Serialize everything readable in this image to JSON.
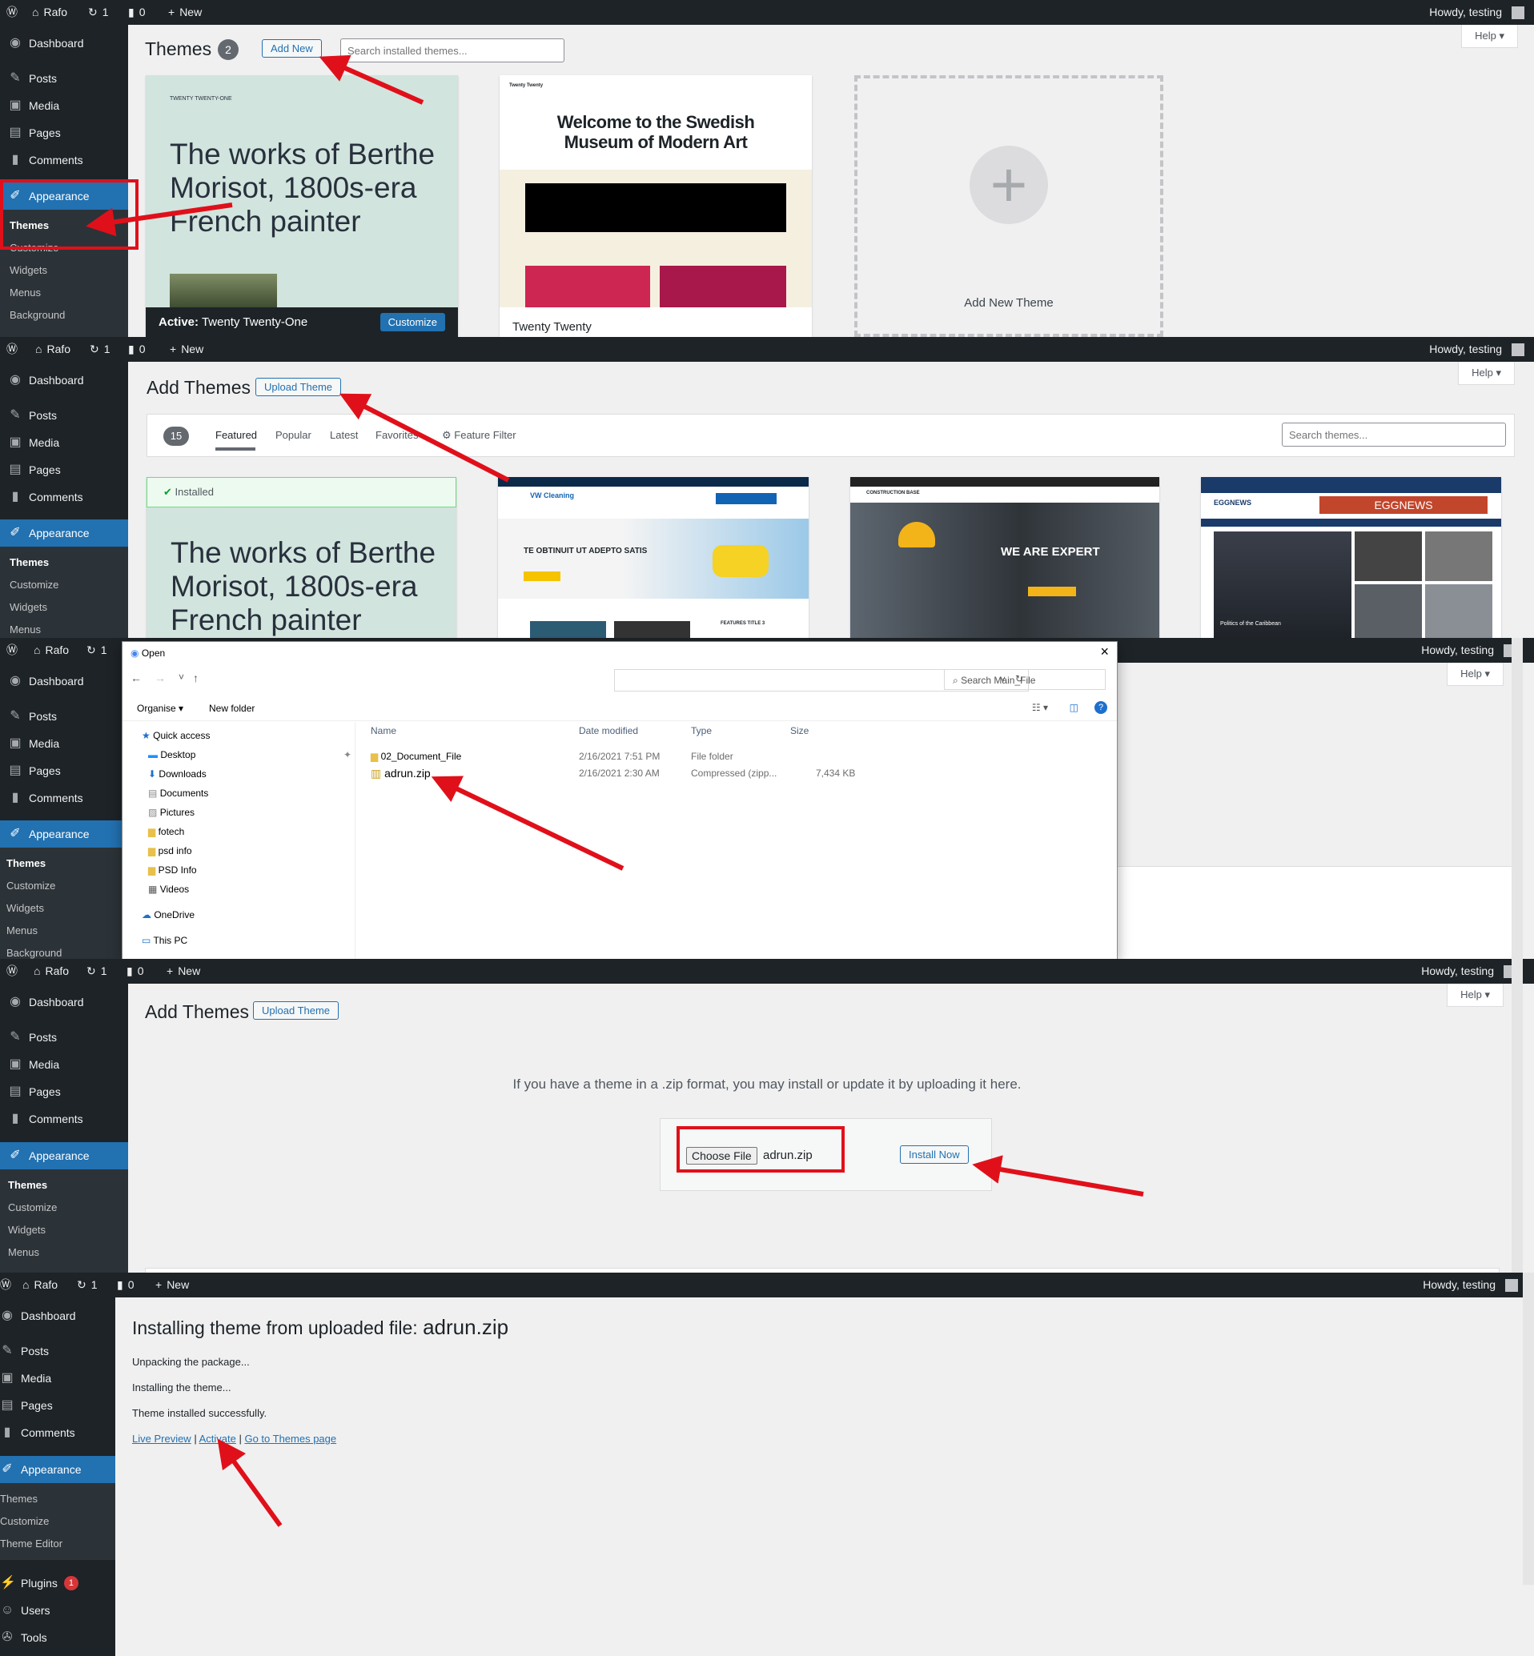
{
  "adminbar": {
    "site": "Rafo",
    "updates": "1",
    "comments": "0",
    "new": "New",
    "howdy": "Howdy, testing"
  },
  "menu": {
    "dashboard": "Dashboard",
    "posts": "Posts",
    "media": "Media",
    "pages": "Pages",
    "comments": "Comments",
    "appearance": "Appearance",
    "plugins": "Plugins",
    "plugins_badge": "1",
    "users": "Users",
    "tools": "Tools"
  },
  "submenu": {
    "themes": "Themes",
    "customize": "Customize",
    "widgets": "Widgets",
    "menus": "Menus",
    "background": "Background",
    "theme_editor": "Theme Editor"
  },
  "help": "Help",
  "panel1": {
    "title": "Themes",
    "count": "2",
    "add_new": "Add New",
    "search_placeholder": "Search installed themes...",
    "theme1": {
      "header_left": "TWENTY TWENTY-ONE",
      "hero": "The works of Berthe Morisot, 1800s-era French painter",
      "active_label": "Active:",
      "active_name": "Twenty Twenty-One",
      "customize": "Customize"
    },
    "theme2": {
      "name": "Twenty Twenty",
      "hero": "Welcome to the Swedish Museum of Modern Art",
      "site": "Twenty Twenty"
    },
    "add_new_theme": "Add New Theme"
  },
  "panel2": {
    "title": "Add Themes",
    "upload": "Upload Theme",
    "count": "15",
    "tabs": [
      "Featured",
      "Popular",
      "Latest",
      "Favorites"
    ],
    "feature_filter": "Feature Filter",
    "search_placeholder": "Search themes...",
    "installed": "Installed",
    "hero": "The works of Berthe Morisot, 1800s-era French painter",
    "card2": {
      "brand": "VW Cleaning",
      "headline": "TE OBTINUIT UT ADEPTO SATIS",
      "sub": "FEATURES TITLE 3"
    },
    "card3": {
      "brand": "CONSTRUCTION BASE",
      "headline": "WE ARE EXPERT"
    },
    "card4": {
      "brand": "EGGNEWS",
      "banner": "EGGNEWS",
      "caption1": "Politics of the Caribbean"
    }
  },
  "dialog": {
    "title": "Open",
    "search": "Search Main_File",
    "organise": "Organise",
    "new_folder": "New folder",
    "columns": [
      "Name",
      "Date modified",
      "Type",
      "Size"
    ],
    "files": [
      {
        "name": "02_Document_File",
        "date": "2/16/2021 7:51 PM",
        "type": "File folder",
        "size": ""
      },
      {
        "name": "adrun.zip",
        "date": "2/16/2021 2:30 AM",
        "type": "Compressed (zipp...",
        "size": "7,434 KB"
      }
    ],
    "nav": [
      "Quick access",
      "Desktop",
      "Downloads",
      "Documents",
      "Pictures",
      "fotech",
      "psd info",
      "PSD Info",
      "Videos",
      "OneDrive",
      "This PC"
    ]
  },
  "panel4": {
    "title": "Add Themes",
    "upload": "Upload Theme",
    "instructions": "If you have a theme in a .zip format, you may install or update it by uploading it here.",
    "choose_file": "Choose File",
    "filename": "adrun.zip",
    "install_now": "Install Now"
  },
  "panel5": {
    "heading_prefix": "Installing theme from uploaded file:",
    "heading_file": "adrun.zip",
    "lines": [
      "Unpacking the package...",
      "Installing the theme...",
      "Theme installed successfully."
    ],
    "links": {
      "live_preview": "Live Preview",
      "activate": "Activate",
      "go_themes": "Go to Themes page"
    }
  },
  "colors": {
    "accent": "#2271b1",
    "adminbar": "#1d2327",
    "highlight_red": "#e0101a"
  }
}
